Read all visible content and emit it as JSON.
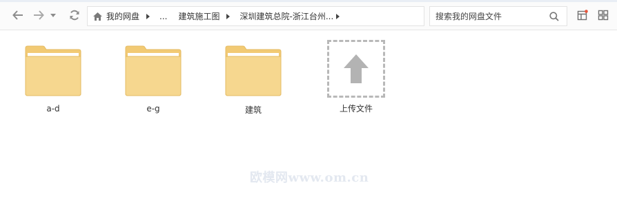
{
  "nav": {
    "back_icon": "arrow-left-icon",
    "forward_icon": "arrow-right-icon",
    "history_icon": "chevron-down-icon",
    "refresh_icon": "refresh-icon"
  },
  "breadcrumb": {
    "home_icon": "home-icon",
    "items": [
      {
        "label": "我的网盘"
      },
      {
        "label": "..."
      },
      {
        "label": "建筑施工图"
      },
      {
        "label": "深圳建筑总院-浙江台州..."
      }
    ]
  },
  "search": {
    "placeholder": "搜索我的网盘文件",
    "value": ""
  },
  "tools": {
    "layout_icon": "layout-toggle-icon",
    "grid_icon": "grid-view-icon",
    "notification_color": "#e8543a"
  },
  "files": [
    {
      "name": "a-d",
      "type": "folder"
    },
    {
      "name": "e-g",
      "type": "folder"
    },
    {
      "name": "建筑",
      "type": "folder"
    }
  ],
  "upload": {
    "label": "上传文件",
    "icon": "upload-arrow-icon"
  },
  "colors": {
    "folder_fill": "#f6d78f",
    "folder_tab": "#f2ca74",
    "folder_stroke": "#e4bb63",
    "upload_border": "#b8b8b8",
    "upload_arrow": "#b3b3b3"
  },
  "watermark": "欧模网www.om.cn"
}
